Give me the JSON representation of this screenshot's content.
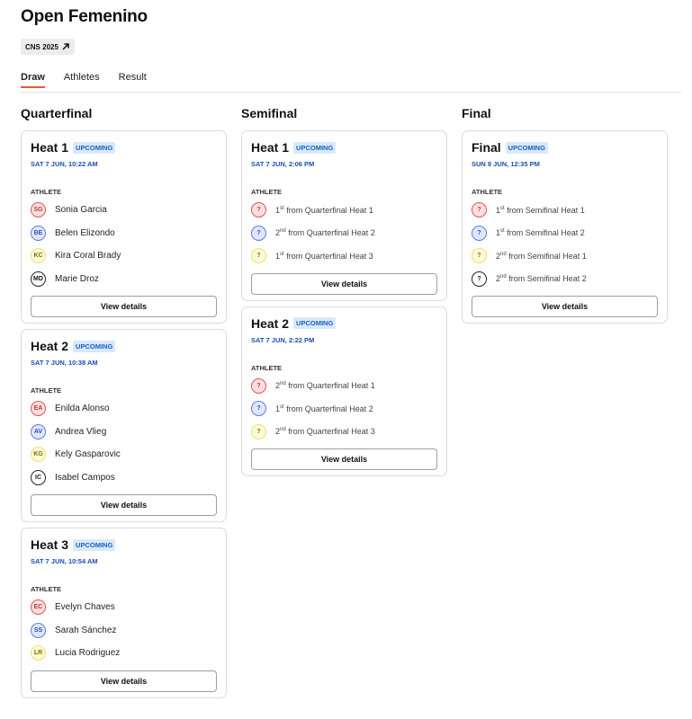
{
  "page": {
    "title": "Open Femenino",
    "event_badge": "CNS 2025"
  },
  "tabs": [
    {
      "label": "Draw"
    },
    {
      "label": "Athletes"
    },
    {
      "label": "Result"
    }
  ],
  "ui": {
    "athlete_label": "ATHLETE",
    "view_details": "View details"
  },
  "columns": [
    {
      "title": "Quarterfinal",
      "cards": [
        {
          "name": "Heat 1",
          "status": "UPCOMING",
          "datetime": "SAT 7 JUN, 10:22 AM",
          "athletes": [
            {
              "initials": "SG",
              "name": "Sonia Garcia"
            },
            {
              "initials": "BE",
              "name": "Belen Elizondo"
            },
            {
              "initials": "KC",
              "name": "Kira Coral Brady"
            },
            {
              "initials": "MD",
              "name": "Marie Droz"
            }
          ]
        },
        {
          "name": "Heat 2",
          "status": "UPCOMING",
          "datetime": "SAT 7 JUN, 10:38 AM",
          "athletes": [
            {
              "initials": "EA",
              "name": "Enilda Alonso"
            },
            {
              "initials": "AV",
              "name": "Andrea Vlieg"
            },
            {
              "initials": "KG",
              "name": "Kely Gasparovic"
            },
            {
              "initials": "IC",
              "name": "Isabel Campos"
            }
          ]
        },
        {
          "name": "Heat 3",
          "status": "UPCOMING",
          "datetime": "SAT 7 JUN, 10:54 AM",
          "athletes": [
            {
              "initials": "EC",
              "name": "Evelyn Chaves"
            },
            {
              "initials": "SS",
              "name": "Sarah Sánchez"
            },
            {
              "initials": "LR",
              "name": "Lucia Rodriguez"
            }
          ]
        }
      ]
    },
    {
      "title": "Semifinal",
      "cards": [
        {
          "name": "Heat 1",
          "status": "UPCOMING",
          "datetime": "SAT 7 JUN, 2:06 PM",
          "athletes": [
            {
              "initials": "?",
              "rank": "1",
              "suffix": "st",
              "source": "from Quarterfinal Heat 1"
            },
            {
              "initials": "?",
              "rank": "2",
              "suffix": "nd",
              "source": "from Quarterfinal Heat 2"
            },
            {
              "initials": "?",
              "rank": "1",
              "suffix": "st",
              "source": "from Quarterfinal Heat 3"
            }
          ]
        },
        {
          "name": "Heat 2",
          "status": "UPCOMING",
          "datetime": "SAT 7 JUN, 2:22 PM",
          "athletes": [
            {
              "initials": "?",
              "rank": "2",
              "suffix": "nd",
              "source": "from Quarterfinal Heat 1"
            },
            {
              "initials": "?",
              "rank": "1",
              "suffix": "st",
              "source": "from Quarterfinal Heat 2"
            },
            {
              "initials": "?",
              "rank": "2",
              "suffix": "nd",
              "source": "from Quarterfinal Heat 3"
            }
          ]
        }
      ]
    },
    {
      "title": "Final",
      "cards": [
        {
          "name": "Final",
          "status": "UPCOMING",
          "datetime": "SUN 8 JUN, 12:35 PM",
          "athletes": [
            {
              "initials": "?",
              "rank": "1",
              "suffix": "st",
              "source": "from Semifinal Heat 1"
            },
            {
              "initials": "?",
              "rank": "1",
              "suffix": "st",
              "source": "from Semifinal Heat 2"
            },
            {
              "initials": "?",
              "rank": "2",
              "suffix": "nd",
              "source": "from Semifinal Heat 1"
            },
            {
              "initials": "?",
              "rank": "2",
              "suffix": "nd",
              "source": "from Semifinal Heat 2"
            }
          ]
        }
      ]
    }
  ]
}
